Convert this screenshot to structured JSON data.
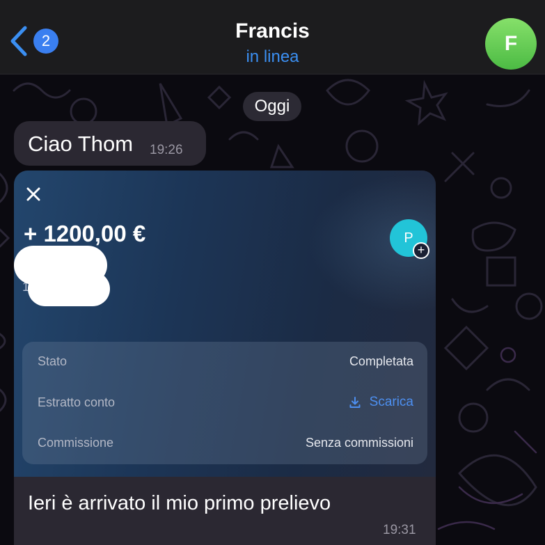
{
  "header": {
    "back_icon": "chevron-left-icon",
    "unread_count": "2",
    "title": "Francis",
    "status": "in linea",
    "avatar_letter": "F",
    "accent_color": "#3b8ff2",
    "avatar_color": "#5cc84f"
  },
  "chat": {
    "date_chip": "Oggi",
    "messages": [
      {
        "text": "Ciao Thom",
        "time": "19:26"
      },
      {
        "text": "Ieri è arrivato il mio primo prelievo",
        "time": "19:31"
      }
    ]
  },
  "transaction_card": {
    "close_icon": "close-icon",
    "amount": "+ 1200,00 €",
    "partial_char": "1",
    "counterparty_avatar_letter": "P",
    "counterparty_avatar_color": "#22c4d8",
    "details": [
      {
        "label": "Stato",
        "value": "Completata"
      },
      {
        "label": "Estratto conto",
        "value": "Scarica",
        "icon": "download-icon"
      },
      {
        "label": "Commissione",
        "value": "Senza commissioni"
      }
    ]
  }
}
